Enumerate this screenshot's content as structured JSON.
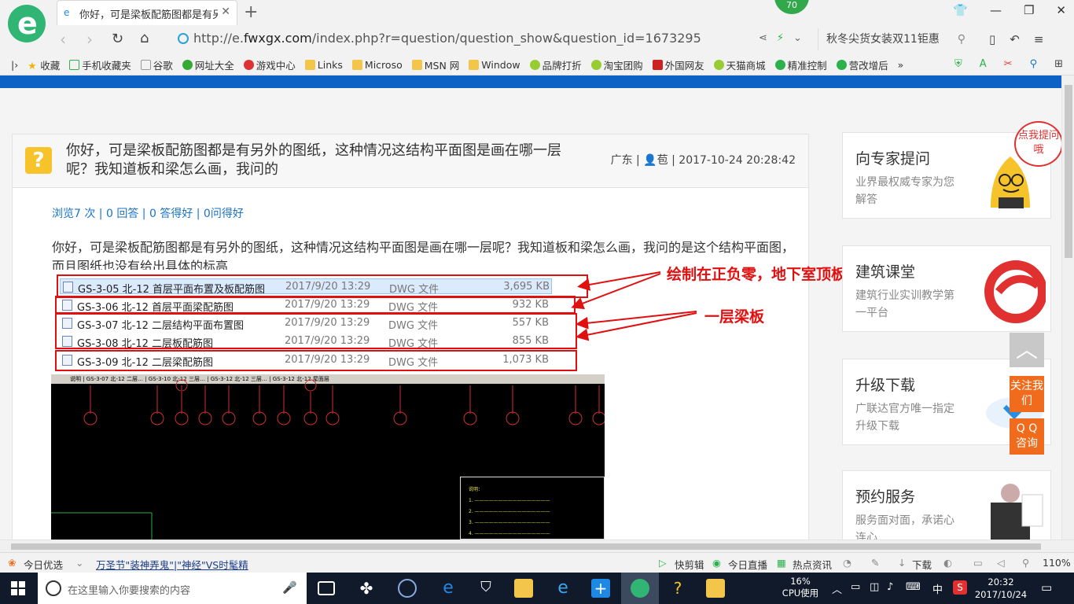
{
  "browser": {
    "tab_title": "你好，可是梁板配筋图都是有另外",
    "badge_number": "70",
    "address_prefix": "http://e.",
    "address_domain": "fwxgx.com",
    "address_path": "/index.php?r=question/question_show&question_id=1673295",
    "search_text": "秋冬尖货女装双11钜惠",
    "bookmarks": [
      "收藏",
      "手机收藏夹",
      "谷歌",
      "网址大全",
      "游戏中心",
      "Links",
      "Microso",
      "MSN 网",
      "Window",
      "品牌打折",
      "淘宝团购",
      "外国网友",
      "天猫商城",
      "精准控制",
      "营改增后"
    ]
  },
  "question": {
    "title": "你好，可是梁板配筋图都是有另外的图纸，这种情况这结构平面图是画在哪一层呢？我知道板和梁怎么画，我问的",
    "region": "广东",
    "user": "苞",
    "datetime": "2017-10-24 20:28:42",
    "stats": "浏览7 次 | 0 回答 | 0 答得好 | 0问得好",
    "body": "你好，可是梁板配筋图都是有另外的图纸，这种情况这结构平面图是画在哪一层呢？我知道板和梁怎么画，我问的是这个结构平面图，而且图纸也没有给出具体的标高"
  },
  "files": [
    {
      "name": "GS-3-05 北-12 首层平面布置及板配筋图",
      "date": "2017/9/20 13:29",
      "type": "DWG 文件",
      "size": "3,695 KB"
    },
    {
      "name": "GS-3-06 北-12 首层平面梁配筋图",
      "date": "2017/9/20 13:29",
      "type": "DWG 文件",
      "size": "932 KB"
    },
    {
      "name": "GS-3-07 北-12 二层结构平面布置图",
      "date": "2017/9/20 13:29",
      "type": "DWG 文件",
      "size": "557 KB"
    },
    {
      "name": "GS-3-08 北-12 二层板配筋图",
      "date": "2017/9/20 13:29",
      "type": "DWG 文件",
      "size": "855 KB"
    },
    {
      "name": "GS-3-09 北-12 二层梁配筋图",
      "date": "2017/9/20 13:29",
      "type": "DWG 文件",
      "size": "1,073 KB"
    }
  ],
  "annotations": {
    "first": "绘制在正负零，地下室顶板",
    "second": "一层梁板"
  },
  "cad": {
    "tab_strip": "说明 | GS-3-07 北-12 二层… | GS-3-10 北-12 三层… | GS-3-12 北-12 三层… | GS-3-12 北-12 屋面层"
  },
  "sidebar": {
    "cards": [
      {
        "title": "向专家提问",
        "desc": "业界最权威专家为您解答"
      },
      {
        "title": "建筑课堂",
        "desc": "建筑行业实训教学第一平台"
      },
      {
        "title": "升级下载",
        "desc": "广联达官方唯一指定升级下载"
      },
      {
        "title": "预约服务",
        "desc": "服务面对面，承诺心连心"
      }
    ],
    "bubble": "点我提问哦",
    "follow_btn": "关注我们",
    "qq_btn": "Q Q 咨询"
  },
  "statusbar": {
    "left_label": "今日优选",
    "headline": "万圣节\"装神弄鬼\"|\"神经\"VS时髦精",
    "items": [
      "快剪辑",
      "今日直播",
      "热点资讯",
      "下载"
    ],
    "zoom": "110%"
  },
  "taskbar": {
    "search_placeholder": "在这里输入你要搜索的内容",
    "cpu_percent": "16%",
    "cpu_label": "CPU使用",
    "ime": "中",
    "time": "20:32",
    "date": "2017/10/24"
  },
  "colors": {
    "brand_blue": "#0d63c5",
    "annotation_red": "#e01010",
    "accent_orange": "#f06b1c"
  }
}
